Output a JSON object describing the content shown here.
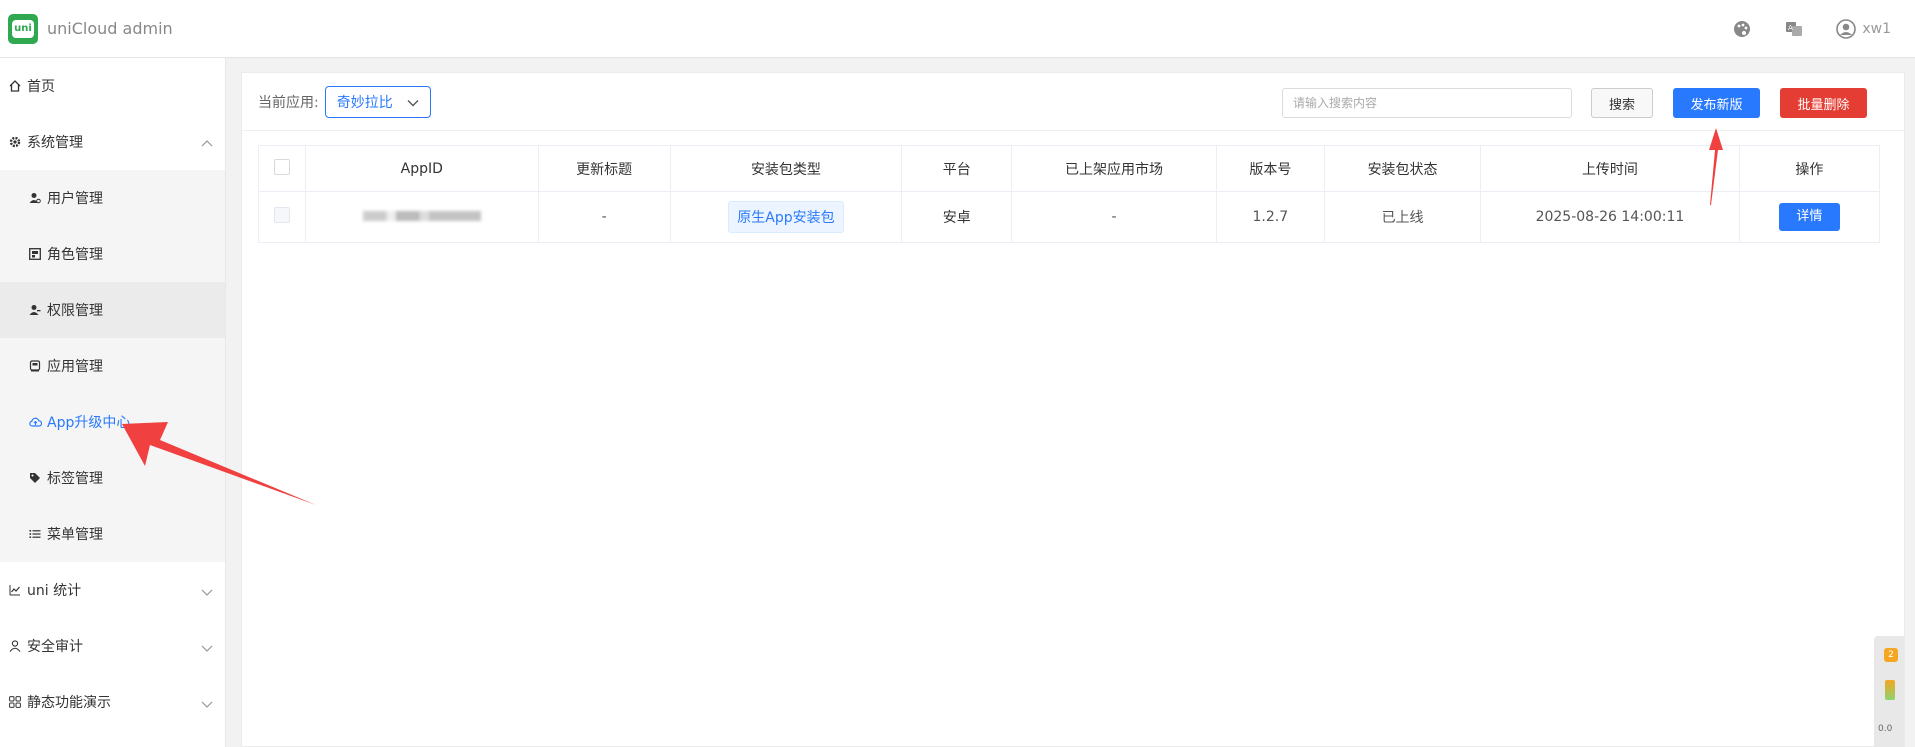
{
  "header": {
    "logo_text": "uni",
    "title": "uniCloud admin",
    "user": "xw1",
    "icons": [
      "palette-icon",
      "translate-icon",
      "user-avatar-icon"
    ]
  },
  "sidebar": {
    "items": [
      {
        "label": "首页",
        "icon": "home-icon"
      },
      {
        "label": "系统管理",
        "icon": "gear-icon",
        "expanded": true
      },
      {
        "label": "uni 统计",
        "icon": "chart-icon"
      },
      {
        "label": "安全审计",
        "icon": "person-icon"
      },
      {
        "label": "静态功能演示",
        "icon": "grid-icon"
      }
    ],
    "submenu": [
      {
        "label": "用户管理",
        "icon": "user-gear-icon"
      },
      {
        "label": "角色管理",
        "icon": "role-icon"
      },
      {
        "label": "权限管理",
        "icon": "permission-icon"
      },
      {
        "label": "应用管理",
        "icon": "app-icon"
      },
      {
        "label": "App升级中心",
        "icon": "cloud-upload-icon",
        "active": true
      },
      {
        "label": "标签管理",
        "icon": "tag-icon"
      },
      {
        "label": "菜单管理",
        "icon": "list-icon"
      }
    ]
  },
  "toolbar": {
    "current_app_label": "当前应用:",
    "current_app_value": "奇妙拉比",
    "search_placeholder": "请输入搜索内容",
    "search_button": "搜索",
    "publish_button": "发布新版",
    "batch_delete_button": "批量删除"
  },
  "table": {
    "columns": [
      "AppID",
      "更新标题",
      "安装包类型",
      "平台",
      "已上架应用市场",
      "版本号",
      "安装包状态",
      "上传时间",
      "操作"
    ],
    "rows": [
      {
        "title": "-",
        "package_type": "原生App安装包",
        "platform": "安卓",
        "store": "-",
        "version": "1.2.7",
        "status": "已上线",
        "upload_time": "2025-08-26 14:00:11",
        "action": "详情"
      }
    ]
  },
  "widget": {
    "badge": "2",
    "speed": "0.0"
  },
  "colors": {
    "primary": "#2979ff",
    "danger": "#e43d33",
    "arrow": "#f04040",
    "logo": "#2fa84f"
  }
}
